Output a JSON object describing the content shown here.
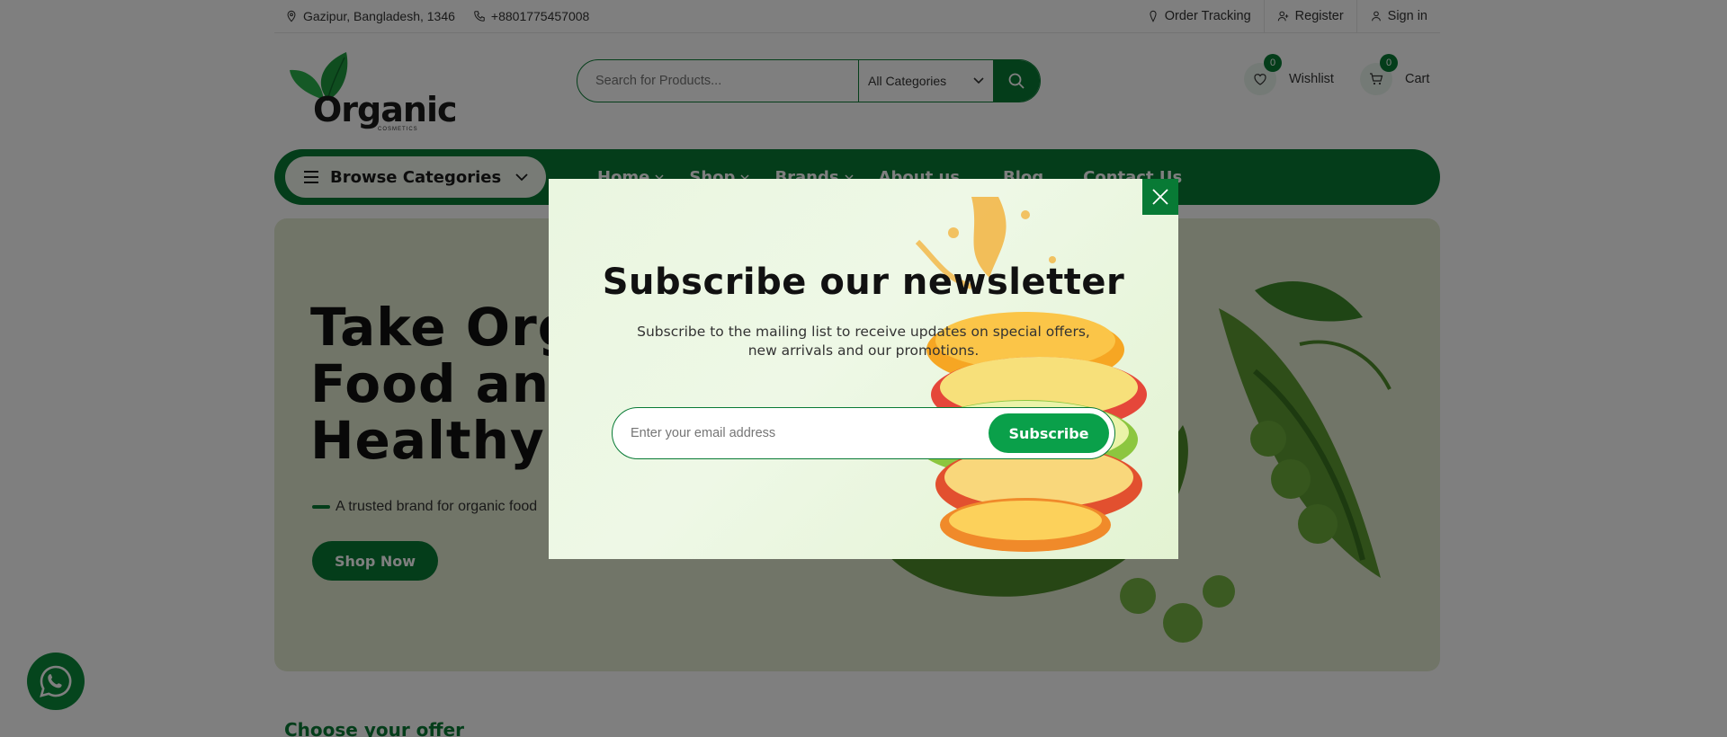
{
  "topbar": {
    "address": "Gazipur, Bangladesh, 1346",
    "phone": "+8801775457008",
    "links": [
      "Order Tracking",
      "Register",
      "Sign in"
    ]
  },
  "logo": {
    "name": "Organic",
    "sub": "COSMETICS"
  },
  "search": {
    "placeholder": "Search for Products...",
    "category": "All Categories"
  },
  "header": {
    "wishlist_label": "Wishlist",
    "wishlist_count": "0",
    "cart_label": "Cart",
    "cart_count": "0"
  },
  "nav": {
    "browse_label": "Browse Categories",
    "links": [
      "Home",
      "Shop",
      "Brands",
      "About us",
      "Blog",
      "Contact Us"
    ]
  },
  "hero": {
    "title_line1": "Take Orga",
    "title_line2": "Food and",
    "title_line3": "Healthy",
    "tagline": "A trusted brand for organic food",
    "cta": "Shop Now"
  },
  "section": {
    "offer_title": "Choose your offer"
  },
  "modal": {
    "title": "Subscribe our newsletter",
    "text": "Subscribe to the mailing list to receive updates on special offers, new arrivals and our promotions.",
    "email_placeholder": "Enter your email address",
    "button": "Subscribe"
  },
  "colors": {
    "brand": "#087a35",
    "accent": "#0aa04a"
  }
}
